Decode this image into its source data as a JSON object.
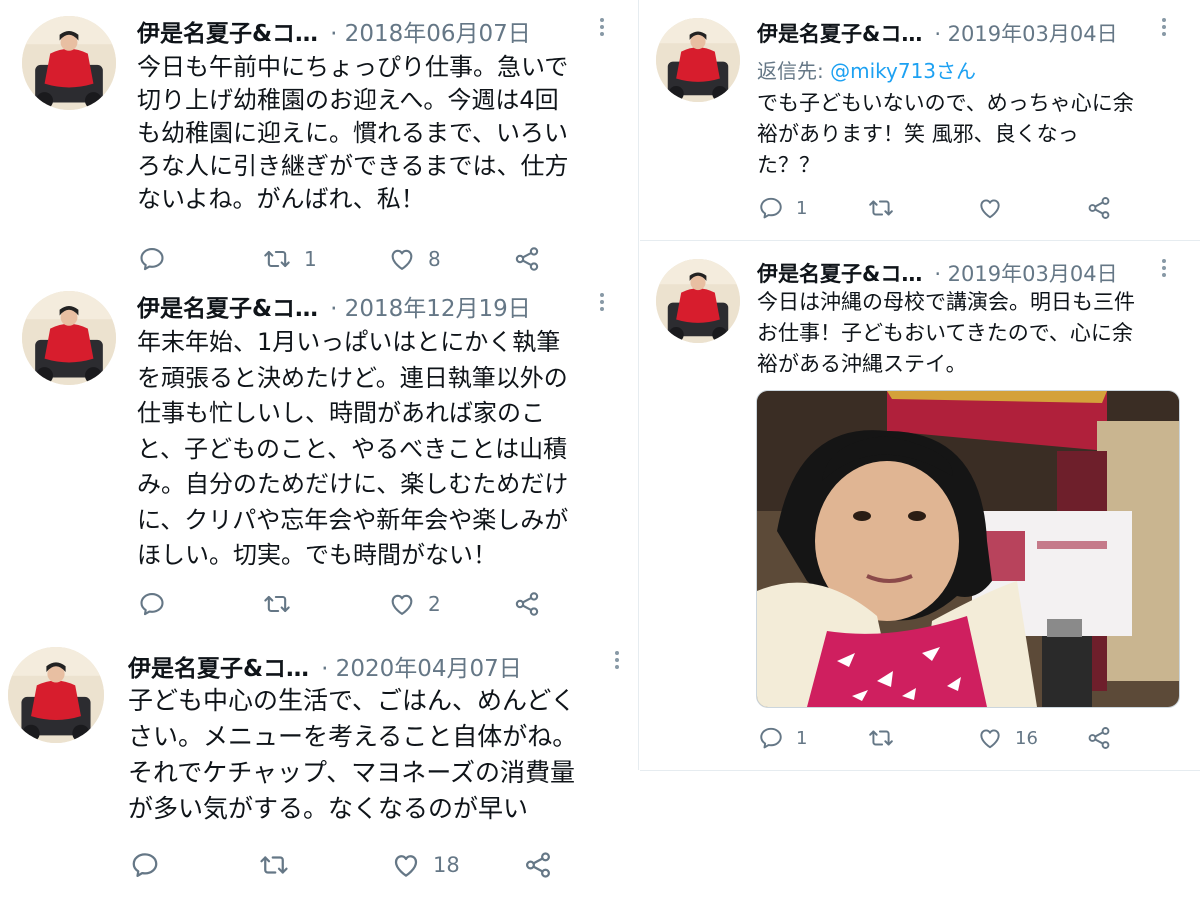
{
  "tweets": [
    {
      "name": "伊是名夏子&コ…",
      "date": "· 2018年06月07日",
      "text": "今日も午前中にちょっぴり仕事。急いで\n切り上げ幼稚園のお迎えへ。今週は4回\nも幼稚園に迎えに。慣れるまで、いろい\nろな人に引き継ぎができるまでは、仕方\nないよね。がんばれ、私！",
      "replies": "",
      "retweets": "1",
      "likes": "8"
    },
    {
      "name": "伊是名夏子&コ…",
      "date": "· 2018年12月19日",
      "text": "年末年始、1月いっぱいはとにかく執筆\nを頑張ると決めたけど。連日執筆以外の\n仕事も忙しいし、時間があれば家のこ\nと、子どものこと、やるべきことは山積\nみ。自分のためだけに、楽しむためだけ\nに、クリパや忘年会や新年会や楽しみが\nほしい。切実。でも時間がない！",
      "replies": "",
      "retweets": "",
      "likes": "2"
    },
    {
      "name": "伊是名夏子&コ…",
      "date": "· 2020年04月07日",
      "text": "子ども中心の生活で、ごはん、めんどく\nさい。メニューを考えること自体がね。\nそれでケチャップ、マヨネーズの消費量\nが多い気がする。なくなるのが早い",
      "replies": "",
      "retweets": "",
      "likes": "18"
    },
    {
      "name": "伊是名夏子&コ…",
      "date": "· 2019年03月04日",
      "reply_prefix": "返信先: ",
      "reply_handle": "@miky713さん",
      "text": "でも子どもいないので、めっちゃ心に余\n裕があります！笑 風邪、良くなっ\nた？？",
      "replies": "1",
      "retweets": "",
      "likes": ""
    },
    {
      "name": "伊是名夏子&コ…",
      "date": "· 2019年03月04日",
      "text": "今日は沖縄の母校で講演会。明日も三件\nお仕事！子どもおいてきたので、心に余\n裕がある沖縄ステイ。",
      "replies": "1",
      "retweets": "",
      "likes": "16"
    }
  ],
  "colors": {
    "text": "#0f1419",
    "muted": "#657786",
    "link": "#1da1f2",
    "divider": "#e6ecf0"
  },
  "icons": [
    "reply-icon",
    "retweet-icon",
    "like-icon",
    "share-icon",
    "more-icon",
    "avatar"
  ]
}
